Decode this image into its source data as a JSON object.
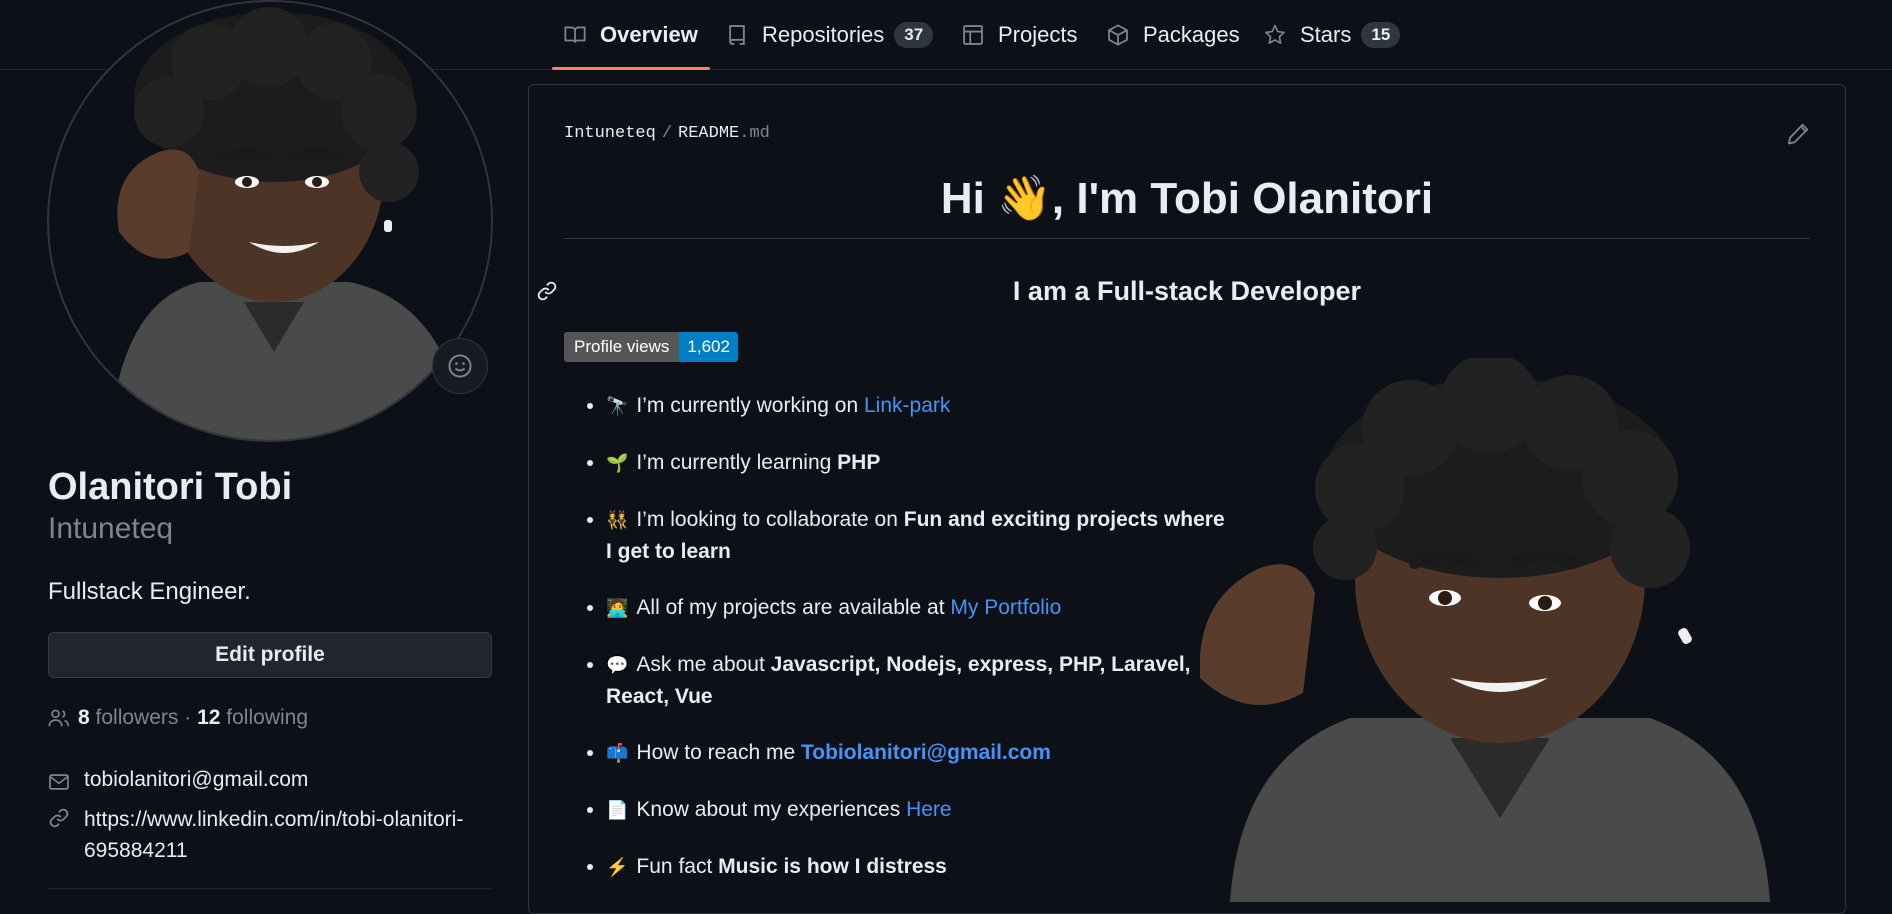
{
  "tabs": [
    {
      "label": "Overview"
    },
    {
      "label": "Repositories",
      "count": "37"
    },
    {
      "label": "Projects"
    },
    {
      "label": "Packages"
    },
    {
      "label": "Stars",
      "count": "15"
    }
  ],
  "profile": {
    "name": "Olanitori Tobi",
    "login": "Intuneteq",
    "bio": "Fullstack Engineer.",
    "edit_label": "Edit profile",
    "followers_count": "8",
    "followers_label": "followers",
    "separator": "·",
    "following_count": "12",
    "following_label": "following",
    "email": "tobiolanitori@gmail.com",
    "link_line1": "https://www.linkedin.com/in/tobi-olanitori-",
    "link_line2": "695884211"
  },
  "readme": {
    "owner": "Intuneteq",
    "sep": "/",
    "file": "README",
    "ext": ".md",
    "heading_pre": "Hi ",
    "heading_emoji": "👋",
    "heading_post": ", I'm Tobi Olanitori",
    "subheading": "I am a Full-stack Developer",
    "badge_label": "Profile views",
    "badge_value": "1,602",
    "items": [
      {
        "emoji": "🔭",
        "text": "I’m currently working on ",
        "link": "Link-park"
      },
      {
        "emoji": "🌱",
        "text": "I’m currently learning ",
        "bold": "PHP"
      },
      {
        "emoji": "👯",
        "text": "I’m looking to collaborate on ",
        "bold": "Fun and exciting projects where I get to learn"
      },
      {
        "emoji": "🧑‍💻",
        "text": "All of my projects are available at ",
        "link": "My Portfolio"
      },
      {
        "emoji": "💬",
        "text": "Ask me about ",
        "bold": "Javascript, Nodejs, express, PHP, Laravel, React, Vue"
      },
      {
        "emoji": "📫",
        "text": "How to reach me ",
        "link": "Tobiolanitori@gmail.com"
      },
      {
        "emoji": "📄",
        "text": "Know about my experiences ",
        "link": "Here"
      },
      {
        "emoji": "⚡",
        "text": "Fun fact ",
        "bold": "Music is how I distress"
      }
    ]
  },
  "colors": {
    "background": "#0d1117",
    "accent_underline": "#f78166",
    "link": "#4493f8",
    "badge_value_bg": "#007ec6"
  }
}
